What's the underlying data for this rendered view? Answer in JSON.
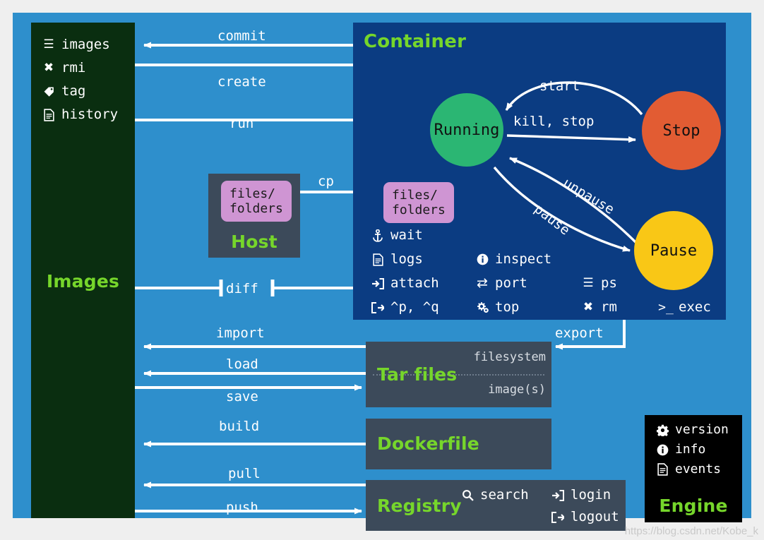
{
  "watermark": "https://blog.csdn.net/Kobe_k",
  "colors": {
    "canvas": "#2e8fcc",
    "images_panel": "#0a2e10",
    "container_panel": "#0b3c82",
    "slate_panel": "#3c4a5a",
    "engine_panel": "#000000",
    "title_green": "#76d62b",
    "running": "#2bb673",
    "stop": "#e25c33",
    "pause": "#f9c716",
    "files_chip": "#cf95d3",
    "line": "#ffffff"
  },
  "images": {
    "title": "Images",
    "commands": [
      {
        "icon": "list-icon",
        "glyph": "☰",
        "label": "images"
      },
      {
        "icon": "close-x-icon",
        "glyph": "✖",
        "label": "rmi"
      },
      {
        "icon": "tag-icon",
        "glyph": "🏷",
        "label": "tag"
      },
      {
        "icon": "file-icon",
        "glyph": "🗎",
        "label": "history"
      }
    ]
  },
  "container": {
    "title": "Container",
    "states": [
      {
        "name": "running-state",
        "label": "Running"
      },
      {
        "name": "stop-state",
        "label": "Stop"
      },
      {
        "name": "pause-state",
        "label": "Pause"
      }
    ],
    "transitions": [
      {
        "name": "start-transition",
        "label": "start"
      },
      {
        "name": "kill-stop-transition",
        "label": "kill, stop"
      },
      {
        "name": "unpause-transition",
        "label": "unpause"
      },
      {
        "name": "pause-transition",
        "label": "pause"
      }
    ],
    "files_chip": "files/\nfolders",
    "commands": [
      {
        "icon": "anchor-icon",
        "glyph": "⚓",
        "label": "wait"
      },
      {
        "icon": "file-icon",
        "glyph": "🗎",
        "label": "logs"
      },
      {
        "icon": "sign-in-icon",
        "glyph": "⮕",
        "label": "attach"
      },
      {
        "icon": "sign-out-icon",
        "glyph": "⮕",
        "label": "^p, ^q"
      },
      {
        "icon": "info-icon",
        "glyph": "ℹ",
        "label": "inspect"
      },
      {
        "icon": "exchange-icon",
        "glyph": "⇄",
        "label": "port"
      },
      {
        "icon": "cogs-icon",
        "glyph": "⚙",
        "label": "top"
      },
      {
        "icon": "list-icon",
        "glyph": "☰",
        "label": "ps"
      },
      {
        "icon": "close-x-icon",
        "glyph": "✖",
        "label": "rm"
      },
      {
        "icon": "terminal-icon",
        "glyph": ">_",
        "label": "exec"
      }
    ]
  },
  "host": {
    "title": "Host",
    "files_chip": "files/\nfolders"
  },
  "tar_files": {
    "title": "Tar files",
    "upper_label": "filesystem",
    "lower_label": "image(s)"
  },
  "dockerfile": {
    "title": "Dockerfile"
  },
  "registry": {
    "title": "Registry",
    "commands": [
      {
        "icon": "search-icon",
        "glyph": "🔍",
        "label": "search"
      },
      {
        "icon": "sign-in-icon",
        "glyph": "⮕",
        "label": "login"
      },
      {
        "icon": "sign-out-icon",
        "glyph": "⮕",
        "label": "logout"
      }
    ]
  },
  "engine": {
    "title": "Engine",
    "commands": [
      {
        "icon": "gear-icon",
        "glyph": "⚙",
        "label": "version"
      },
      {
        "icon": "info-icon",
        "glyph": "ℹ",
        "label": "info"
      },
      {
        "icon": "file-icon",
        "glyph": "🗎",
        "label": "events"
      }
    ]
  },
  "edges": [
    {
      "name": "commit-edge",
      "label": "commit"
    },
    {
      "name": "create-edge",
      "label": "create"
    },
    {
      "name": "run-edge",
      "label": "run"
    },
    {
      "name": "cp-edge",
      "label": "cp"
    },
    {
      "name": "diff-edge",
      "label": "diff"
    },
    {
      "name": "import-edge",
      "label": "import"
    },
    {
      "name": "load-edge",
      "label": "load"
    },
    {
      "name": "save-edge",
      "label": "save"
    },
    {
      "name": "build-edge",
      "label": "build"
    },
    {
      "name": "pull-edge",
      "label": "pull"
    },
    {
      "name": "push-edge",
      "label": "push"
    },
    {
      "name": "export-edge",
      "label": "export"
    }
  ]
}
